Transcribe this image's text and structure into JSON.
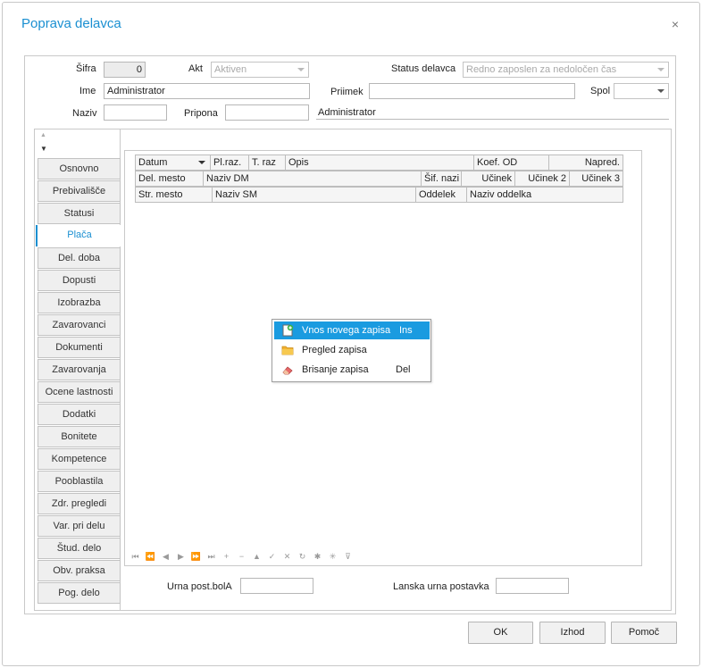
{
  "window": {
    "title": "Poprava delavca",
    "close_glyph": "×"
  },
  "form": {
    "sifra_label": "Šifra",
    "sifra_value": "0",
    "akt_label": "Akt",
    "akt_value": "Aktiven",
    "status_label": "Status delavca",
    "status_value": "Redno zaposlen za nedoločen čas",
    "ime_label": "Ime",
    "ime_value": "Administrator",
    "priimek_label": "Priimek",
    "priimek_value": "",
    "spol_label": "Spol",
    "spol_value": "",
    "naziv_label": "Naziv",
    "naziv_value": "",
    "pripona_label": "Pripona",
    "pripona_value": "",
    "display_name": "Administrator"
  },
  "tabs": [
    {
      "label": "Osnovno",
      "active": false
    },
    {
      "label": "Prebivališče",
      "active": false
    },
    {
      "label": "Statusi",
      "active": false
    },
    {
      "label": "Plača",
      "active": true
    },
    {
      "label": "Del. doba",
      "active": false
    },
    {
      "label": "Dopusti",
      "active": false
    },
    {
      "label": "Izobrazba",
      "active": false
    },
    {
      "label": "Zavarovanci",
      "active": false
    },
    {
      "label": "Dokumenti",
      "active": false
    },
    {
      "label": "Zavarovanja",
      "active": false
    },
    {
      "label": "Ocene lastnosti",
      "active": false
    },
    {
      "label": "Dodatki",
      "active": false
    },
    {
      "label": "Bonitete",
      "active": false
    },
    {
      "label": "Kompetence",
      "active": false
    },
    {
      "label": "Pooblastila",
      "active": false
    },
    {
      "label": "Zdr. pregledi",
      "active": false
    },
    {
      "label": "Var. pri delu",
      "active": false
    },
    {
      "label": "Štud. delo",
      "active": false
    },
    {
      "label": "Obv. praksa",
      "active": false
    },
    {
      "label": "Pog. delo",
      "active": false
    }
  ],
  "grid": {
    "row1": [
      "Datum",
      "Pl.raz.",
      "T. raz",
      "Opis",
      "Koef. OD",
      "Napred."
    ],
    "row2": [
      "Del. mesto",
      "Naziv DM",
      "Šif. nazi",
      "Učinek",
      "Učinek 2",
      "Učinek 3"
    ],
    "row3": [
      "Str. mesto",
      "Naziv SM",
      "Oddelek",
      "Naziv oddelka"
    ]
  },
  "navigator": [
    "⏮",
    "⏪",
    "◀",
    "▶",
    "⏩",
    "⏭",
    "+",
    "−",
    "▲",
    "✓",
    "✕",
    "↻",
    "✱",
    "✳",
    "⊽"
  ],
  "context_menu": {
    "items": [
      {
        "label": "Vnos novega zapisa",
        "shortcut": "Ins",
        "icon": "new-record-icon",
        "highlighted": true
      },
      {
        "label": "Pregled zapisa",
        "shortcut": "",
        "icon": "folder-icon",
        "highlighted": false
      },
      {
        "label": "Brisanje zapisa",
        "shortcut": "Del",
        "icon": "eraser-icon",
        "highlighted": false
      }
    ]
  },
  "bottom_fields": {
    "urna_label": "Urna post.bolA",
    "urna_value": "",
    "lanska_label": "Lanska urna postavka",
    "lanska_value": ""
  },
  "buttons": {
    "ok": "OK",
    "izhod": "Izhod",
    "pomoc": "Pomoč"
  },
  "colors": {
    "accent": "#1a8fd1",
    "menu_highlight": "#1a9be0"
  }
}
